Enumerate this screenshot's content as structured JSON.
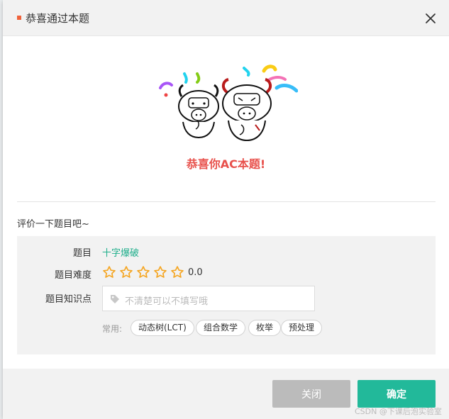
{
  "dialog": {
    "title": "恭喜通过本题"
  },
  "success": {
    "message": "恭喜你AC本题!"
  },
  "rating": {
    "prompt": "评价一下题目吧~",
    "problem_label": "题目",
    "problem_name": "十字爆破",
    "difficulty_label": "题目难度",
    "star_count": 5,
    "difficulty_value": "0.0",
    "tags_label": "题目知识点",
    "tags_placeholder": "不清楚可以不填写哦",
    "common_label": "常用:",
    "common_tags": [
      "动态树(LCT)",
      "组合数学",
      "枚举",
      "预处理"
    ]
  },
  "footer": {
    "close_label": "关闭",
    "ok_label": "确定"
  },
  "watermark": "CSDN @下课后泡实验室",
  "colors": {
    "accent": "#22b99a",
    "link": "#1fae8b",
    "congrats": "#e8514c",
    "title_mark": "#f0623b",
    "star": "#f5a623"
  },
  "icons": {
    "close": "close-icon",
    "star": "star-outline-icon",
    "tag": "tag-icon"
  }
}
